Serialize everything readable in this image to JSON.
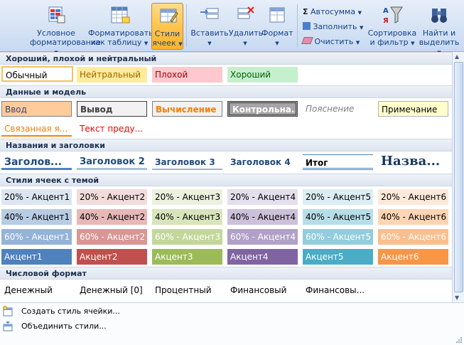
{
  "ribbon": {
    "conditional_formatting": "Условное форматирование",
    "format_as_table": "Форматировать как таблицу",
    "cell_styles": "Стили ячеек",
    "insert": "Вставить",
    "delete": "Удалить",
    "format": "Формат",
    "autosum": "Автосумма",
    "fill": "Заполнить",
    "clear": "Очистить",
    "sort_filter": "Сортировка и фильтр",
    "find_select": "Найти и выделить"
  },
  "sections": {
    "good_bad": "Хороший, плохой и нейтральный",
    "data_model": "Данные и модель",
    "titles": "Названия и заголовки",
    "themed": "Стили ячеек с темой",
    "number": "Числовой формат"
  },
  "good_bad": [
    "Обычный",
    "Нейтральный",
    "Плохой",
    "Хороший"
  ],
  "data_model_row1": [
    "Ввод",
    "Вывод",
    "Вычисление",
    "Контрольна...",
    "Пояснение",
    "Примечание"
  ],
  "data_model_row2": [
    "Связанная я...",
    "Текст преду..."
  ],
  "titles": [
    "Заголов...",
    "Заголовок 2",
    "Заголовок 3",
    "Заголовок 4",
    "Итог",
    "Назва..."
  ],
  "accent20": [
    "20% - Акцент1",
    "20% - Акцент2",
    "20% - Акцент3",
    "20% - Акцент4",
    "20% - Акцент5",
    "20% - Акцент6"
  ],
  "accent40": [
    "40% - Акцент1",
    "40% - Акцент2",
    "40% - Акцент3",
    "40% - Акцент4",
    "40% - Акцент5",
    "40% - Акцент6"
  ],
  "accent60": [
    "60% - Акцент1",
    "60% - Акцент2",
    "60% - Акцент3",
    "60% - Акцент4",
    "60% - Акцент5",
    "60% - Акцент6"
  ],
  "accent": [
    "Акцент1",
    "Акцент2",
    "Акцент3",
    "Акцент4",
    "Акцент5",
    "Акцент6"
  ],
  "number_formats": [
    "Денежный",
    "Денежный [0]",
    "Процентный",
    "Финансовый",
    "Финансовы..."
  ],
  "footer": {
    "create_style": "Создать стиль ячейки...",
    "merge_styles": "Объединить стили..."
  },
  "colors": {
    "accent1": "#4f81bd",
    "accent2": "#c0504d",
    "accent3": "#9bbb59",
    "accent4": "#8064a2",
    "accent5": "#4bacc6",
    "accent6": "#f79646"
  }
}
